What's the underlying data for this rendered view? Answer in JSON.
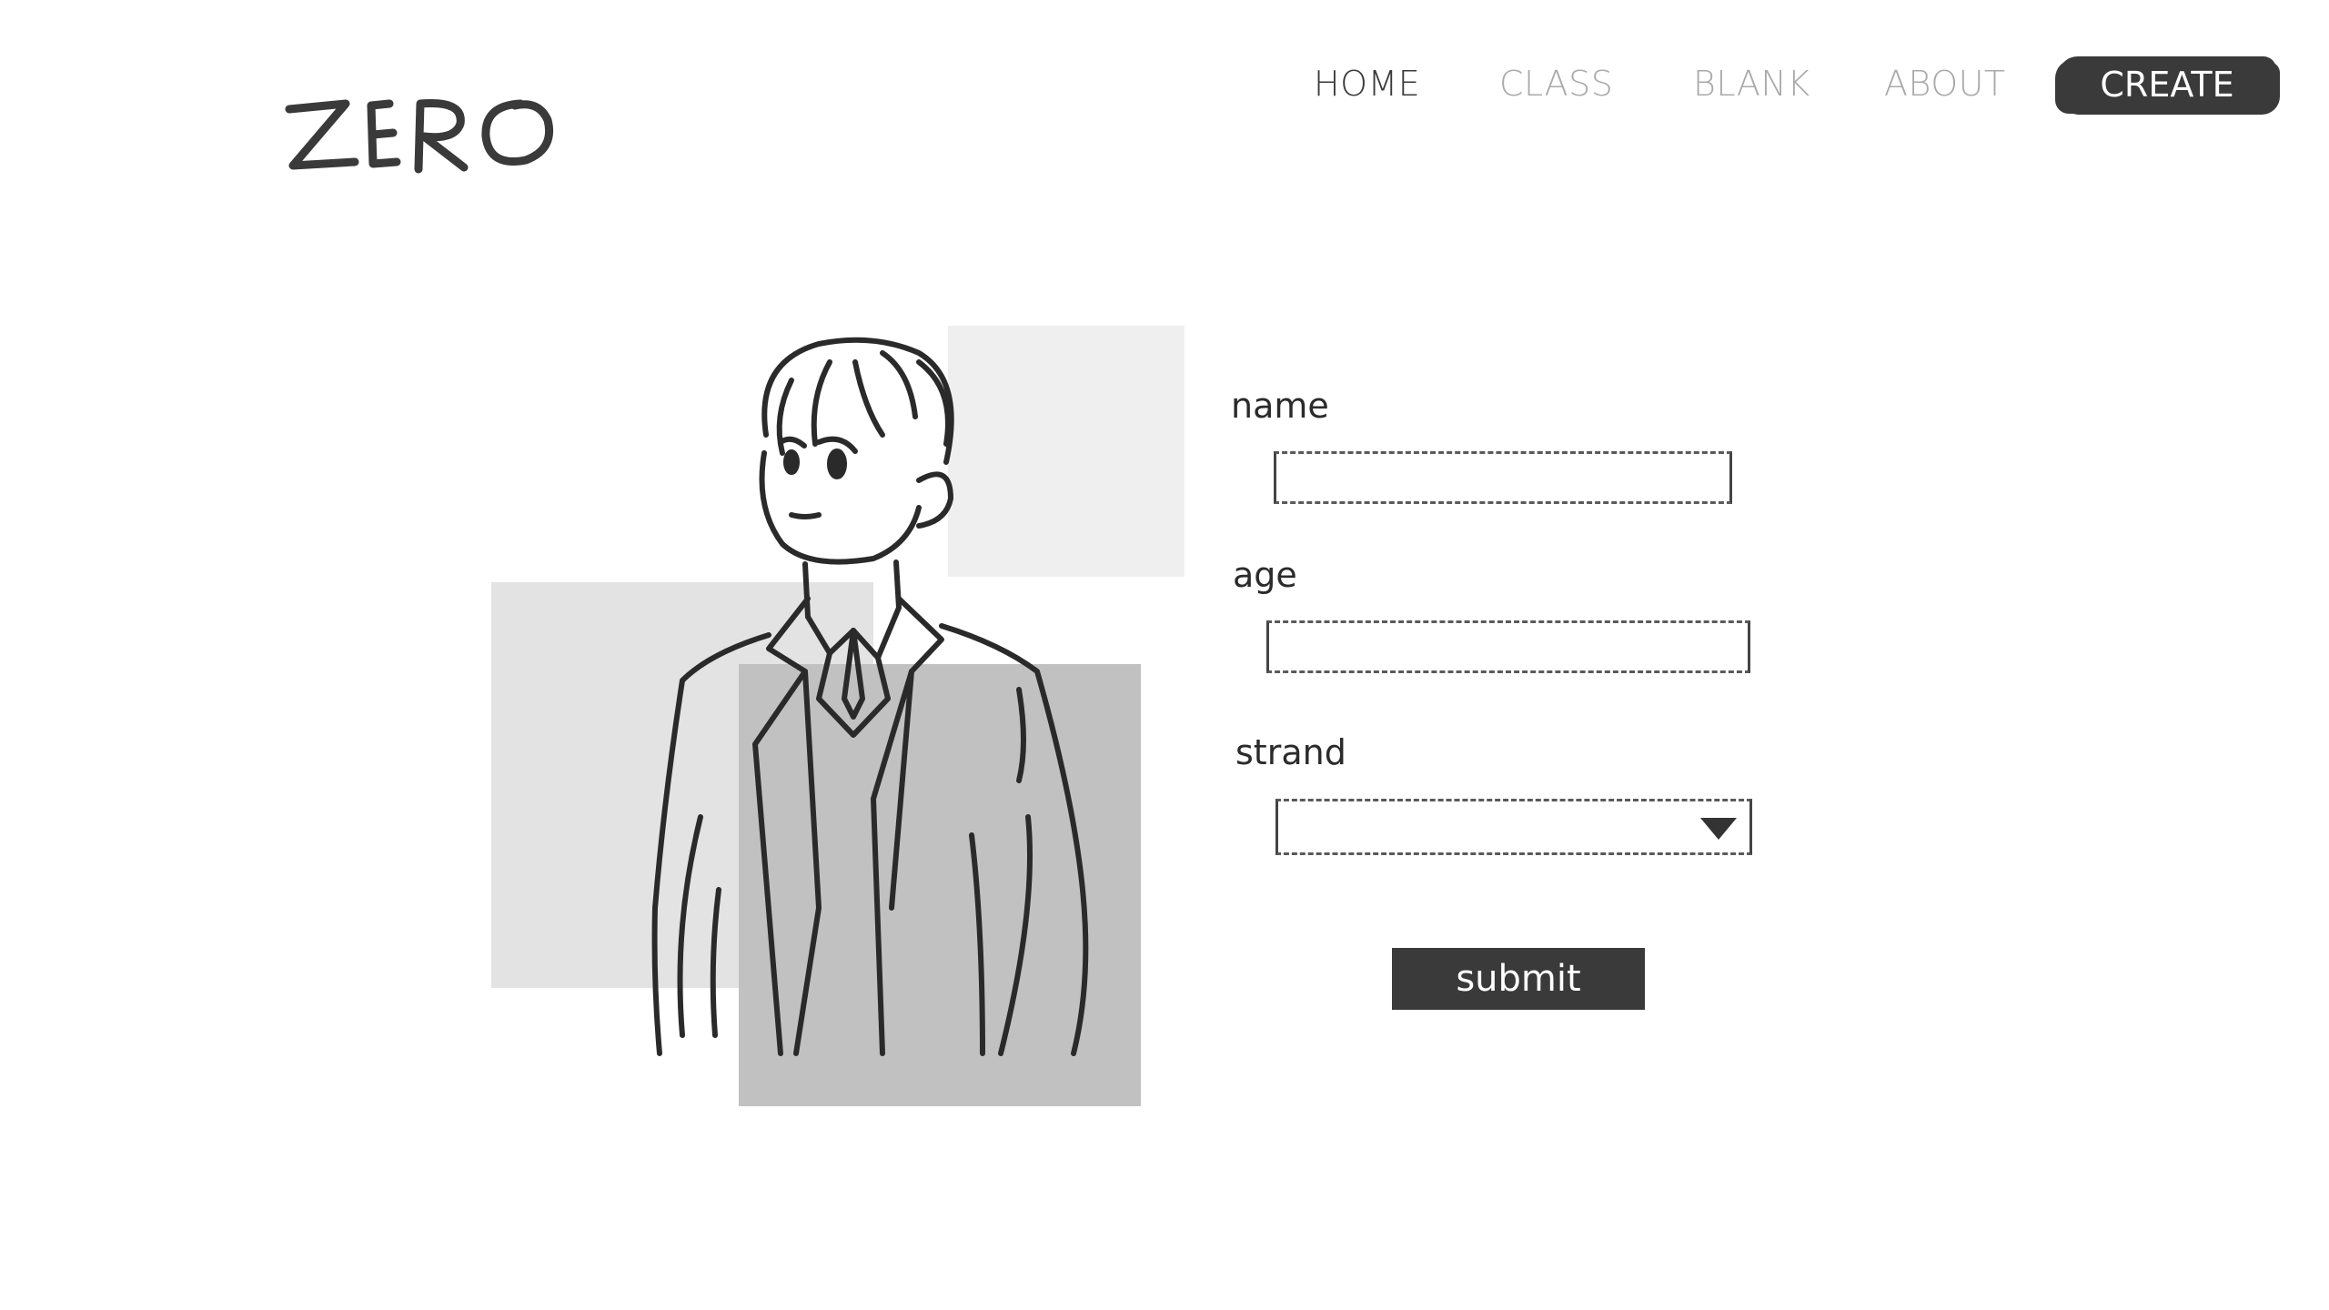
{
  "logo": {
    "text": "ZERO"
  },
  "nav": {
    "items": [
      {
        "label": "HOME",
        "active": true
      },
      {
        "label": "CLASS",
        "active": false
      },
      {
        "label": "BLANK",
        "active": false
      },
      {
        "label": "ABOUT",
        "active": false
      }
    ],
    "cta_label": "CREATE"
  },
  "form": {
    "name": {
      "label": "name",
      "value": ""
    },
    "age": {
      "label": "age",
      "value": ""
    },
    "strand": {
      "label": "strand",
      "selected": ""
    },
    "submit_label": "submit"
  },
  "colors": {
    "primary": "#3a3a3a",
    "nav_inactive": "#aaaaaa",
    "block_light": "#efefef",
    "block_mid": "#e3e3e3",
    "block_dark": "#c1c1c1"
  }
}
